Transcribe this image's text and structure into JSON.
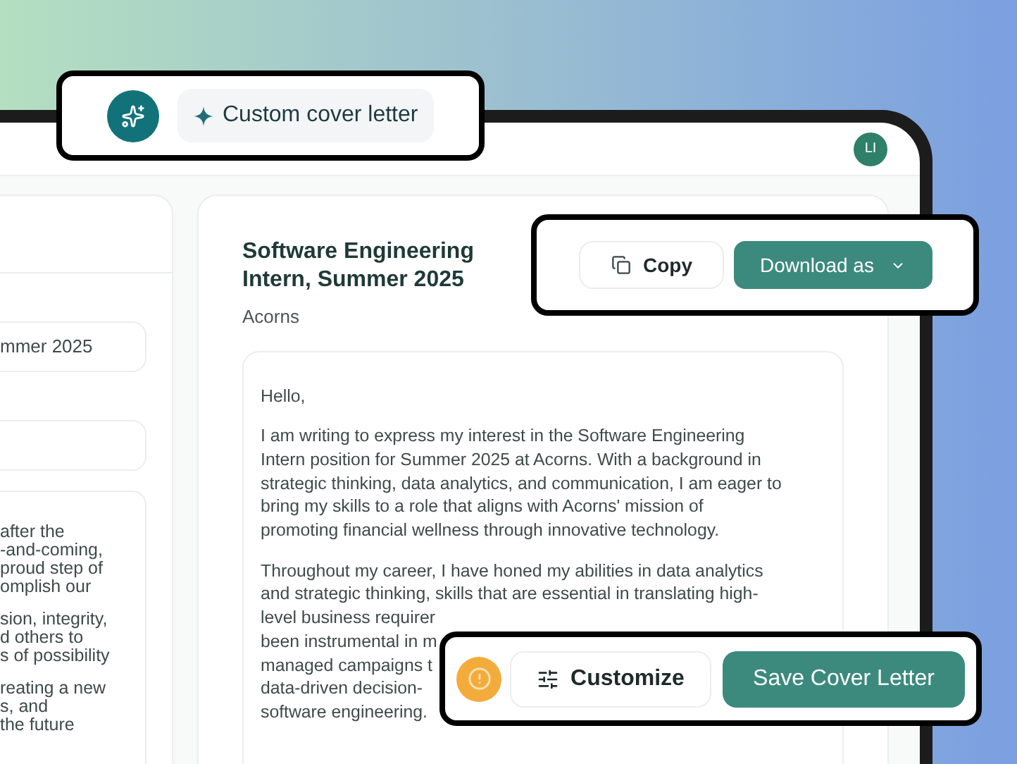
{
  "feature_badge": {
    "label": "Custom cover letter"
  },
  "header": {
    "avatar": "LI"
  },
  "left_panel": {
    "job_field": "mmer 2025",
    "description_paragraphs": [
      [
        "after the",
        "-and-coming,",
        "proud step of",
        "omplish our"
      ],
      [
        "sion, integrity,",
        "d others to",
        "s of possibility"
      ],
      [
        "reating a new",
        "s, and",
        "the future"
      ]
    ]
  },
  "job": {
    "title": "Software Engineering Intern, Summer 2025",
    "company": "Acorns"
  },
  "actions": {
    "copy": "Copy",
    "download": "Download as"
  },
  "letter": {
    "greeting": "Hello,",
    "paragraphs": [
      [
        "I am writing to express my interest in the Software Engineering",
        "Intern position for Summer 2025 at Acorns. With a background in",
        "strategic thinking, data analytics, and communication, I am eager to",
        "bring my skills to a role that aligns with Acorns' mission of",
        "promoting financial wellness through innovative technology."
      ],
      [
        "Throughout my career, I have honed my abilities in data analytics",
        "and strategic thinking, skills that are essential in translating high-",
        "level business requirer",
        "been instrumental in m",
        "managed campaigns t",
        "data-driven decision-",
        "software engineering."
      ]
    ]
  },
  "bottom_bar": {
    "customize": "Customize",
    "save": "Save Cover Letter"
  }
}
